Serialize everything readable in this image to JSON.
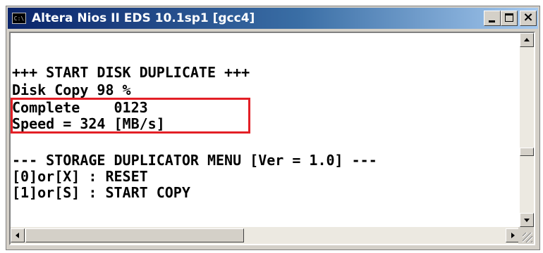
{
  "window": {
    "title": "Altera Nios II EDS 10.1sp1 [gcc4]",
    "icon_text": "C:\\",
    "icon": "console-app-icon"
  },
  "titlebar_buttons": {
    "minimize": "minimize-icon",
    "maximize": "maximize-icon",
    "close_label": "×"
  },
  "console": {
    "lines": [
      "",
      "+++ START DISK DUPLICATE +++",
      "Disk Copy 98 %",
      "Complete    0123",
      "Speed = 324 [MB/s]",
      "",
      "--- STORAGE DUPLICATOR MENU [Ver = 1.0] ---",
      "[0]or[X] : RESET",
      "[1]or[S] : START COPY"
    ]
  },
  "colors": {
    "highlight_border": "#e31f26",
    "console_bg": "#ffffff",
    "console_text": "#000000",
    "titlebar_start": "#0a246a",
    "titlebar_end": "#a6caf0"
  }
}
